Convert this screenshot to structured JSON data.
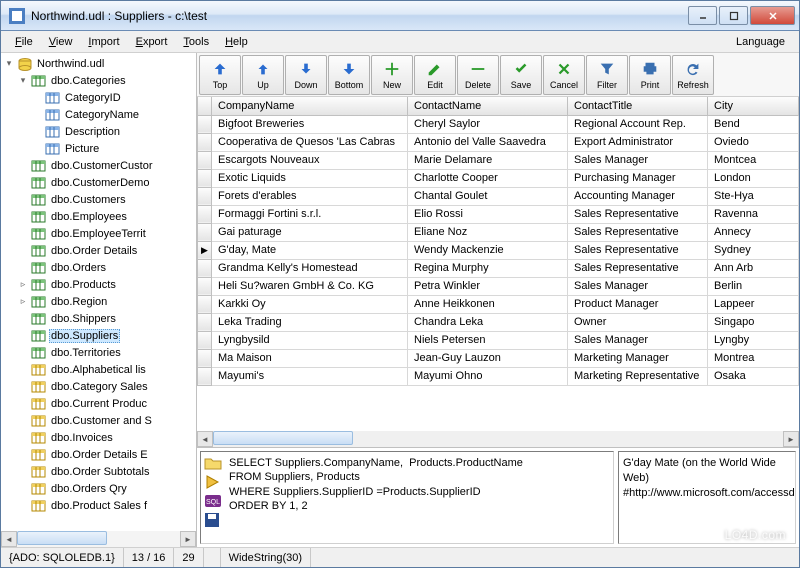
{
  "window": {
    "title": "Northwind.udl : Suppliers - c:\\test"
  },
  "menu": {
    "file": "File",
    "view": "View",
    "import": "Import",
    "export": "Export",
    "tools": "Tools",
    "help": "Help",
    "language": "Language"
  },
  "tree": {
    "root": "Northwind.udl",
    "categories_table": "dbo.Categories",
    "columns": {
      "category_id": "CategoryID",
      "category_name": "CategoryName",
      "description": "Description",
      "picture": "Picture"
    },
    "tables": {
      "customer_customer": "dbo.CustomerCustor",
      "customer_demo": "dbo.CustomerDemo",
      "customers": "dbo.Customers",
      "employees": "dbo.Employees",
      "employee_territories": "dbo.EmployeeTerrit",
      "order_details": "dbo.Order Details",
      "orders": "dbo.Orders",
      "products": "dbo.Products",
      "region": "dbo.Region",
      "shippers": "dbo.Shippers",
      "suppliers": "dbo.Suppliers",
      "territories": "dbo.Territories",
      "alphabetical": "dbo.Alphabetical lis",
      "category_sales": "dbo.Category Sales",
      "current_products": "dbo.Current Produc",
      "customer_and_s": "dbo.Customer and S",
      "invoices": "dbo.Invoices",
      "order_details_ex": "dbo.Order Details E",
      "order_subtotals": "dbo.Order Subtotals",
      "orders_qry": "dbo.Orders Qry",
      "product_sales": "dbo.Product Sales f"
    }
  },
  "toolbar": {
    "top": "Top",
    "up": "Up",
    "down": "Down",
    "bottom": "Bottom",
    "new": "New",
    "edit": "Edit",
    "delete": "Delete",
    "save": "Save",
    "cancel": "Cancel",
    "filter": "Filter",
    "print": "Print",
    "refresh": "Refresh"
  },
  "grid": {
    "headers": {
      "company": "CompanyName",
      "contact": "ContactName",
      "title": "ContactTitle",
      "city": "City"
    },
    "rows": [
      {
        "company": "Bigfoot Breweries",
        "contact": "Cheryl Saylor",
        "title": "Regional Account Rep.",
        "city": "Bend"
      },
      {
        "company": "Cooperativa de Quesos 'Las Cabras",
        "contact": "Antonio del Valle Saavedra",
        "title": "Export Administrator",
        "city": "Oviedo"
      },
      {
        "company": "Escargots Nouveaux",
        "contact": "Marie Delamare",
        "title": "Sales Manager",
        "city": "Montcea"
      },
      {
        "company": "Exotic Liquids",
        "contact": "Charlotte Cooper",
        "title": "Purchasing Manager",
        "city": "London"
      },
      {
        "company": "Forets d'erables",
        "contact": "Chantal Goulet",
        "title": "Accounting Manager",
        "city": "Ste-Hya"
      },
      {
        "company": "Formaggi Fortini s.r.l.",
        "contact": "Elio Rossi",
        "title": "Sales Representative",
        "city": "Ravenna"
      },
      {
        "company": "Gai paturage",
        "contact": "Eliane Noz",
        "title": "Sales Representative",
        "city": "Annecy"
      },
      {
        "company": "G'day, Mate",
        "contact": "Wendy Mackenzie",
        "title": "Sales Representative",
        "city": "Sydney",
        "current": true
      },
      {
        "company": "Grandma Kelly's Homestead",
        "contact": "Regina Murphy",
        "title": "Sales Representative",
        "city": "Ann Arb"
      },
      {
        "company": "Heli Su?waren GmbH & Co. KG",
        "contact": "Petra Winkler",
        "title": "Sales Manager",
        "city": "Berlin"
      },
      {
        "company": "Karkki Oy",
        "contact": "Anne Heikkonen",
        "title": "Product Manager",
        "city": "Lappeer"
      },
      {
        "company": "Leka Trading",
        "contact": "Chandra Leka",
        "title": "Owner",
        "city": "Singapo"
      },
      {
        "company": "Lyngbysild",
        "contact": "Niels Petersen",
        "title": "Sales Manager",
        "city": "Lyngby"
      },
      {
        "company": "Ma Maison",
        "contact": "Jean-Guy Lauzon",
        "title": "Marketing Manager",
        "city": "Montrea"
      },
      {
        "company": "Mayumi's",
        "contact": "Mayumi Ohno",
        "title": "Marketing Representative",
        "city": "Osaka"
      }
    ]
  },
  "sql": {
    "line1": "SELECT Suppliers.CompanyName,  Products.ProductName",
    "line2": "FROM Suppliers, Products",
    "line3": "WHERE Suppliers.SupplierID =Products.SupplierID",
    "line4": "ORDER BY 1, 2"
  },
  "detail": {
    "text": "G'day Mate (on the World Wide Web) #http://www.microsoft.com/accessdev/sampleapps/gdaymate.htm#"
  },
  "status": {
    "provider": "{ADO: SQLOLEDB.1}",
    "position": "13 / 16",
    "extra": "29",
    "type": "WideString(30)"
  },
  "watermark": "LO4D.com"
}
